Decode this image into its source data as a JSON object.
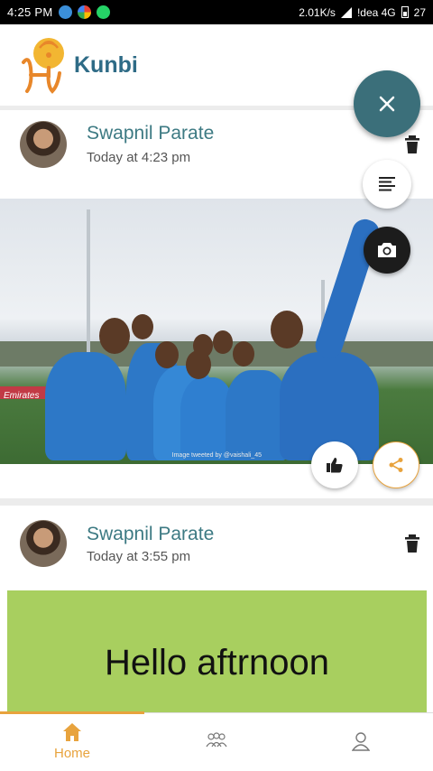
{
  "status_bar": {
    "time": "4:25 PM",
    "network_speed": "2.01K/s",
    "carrier": "!dea 4G",
    "battery_level": "27"
  },
  "app": {
    "title": "Kunbi",
    "brand_color": "#2e6b86",
    "accent_color": "#e8a33d"
  },
  "posts": [
    {
      "author": "Swapnil Parate",
      "time": "Today at 4:23 pm",
      "type": "image",
      "image_banner_text": "Emirates",
      "image_caption": "Image tweeted by @vaishali_45"
    },
    {
      "author": "Swapnil Parate",
      "time": "Today at 3:55 pm",
      "type": "text",
      "text": "Hello aftrnoon",
      "background_color": "#a8cf5f"
    }
  ],
  "fab": {
    "main_icon": "close-icon",
    "options": [
      "text-post-icon",
      "camera-icon"
    ]
  },
  "bottom_nav": {
    "items": [
      {
        "label": "Home",
        "icon": "home-icon",
        "active": true
      },
      {
        "label": "",
        "icon": "community-icon",
        "active": false
      },
      {
        "label": "",
        "icon": "profile-icon",
        "active": false
      }
    ]
  }
}
